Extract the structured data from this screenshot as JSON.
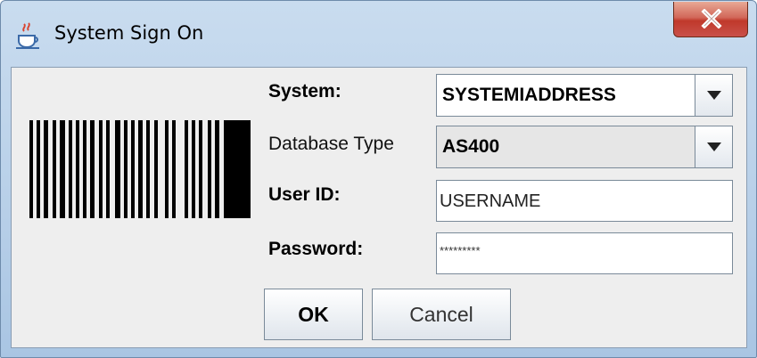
{
  "window": {
    "title": "System Sign On"
  },
  "form": {
    "system": {
      "label": "System:",
      "value": "SYSTEMIADDRESS"
    },
    "database_type": {
      "label": "Database Type",
      "value": "AS400"
    },
    "user_id": {
      "label": "User ID:",
      "value": "USERNAME"
    },
    "password": {
      "label": "Password:",
      "value": "*********"
    }
  },
  "buttons": {
    "ok": "OK",
    "cancel": "Cancel"
  },
  "icons": {
    "app": "java-coffee-icon",
    "close": "close-icon",
    "dropdown": "chevron-down-icon",
    "barcode": "barcode-image"
  }
}
